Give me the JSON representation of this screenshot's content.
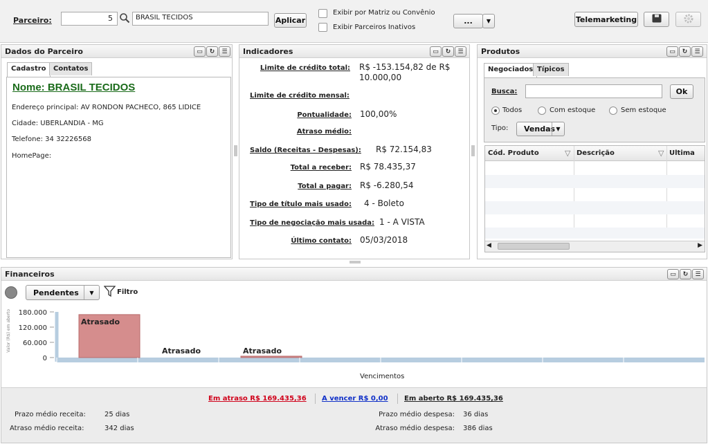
{
  "topbar": {
    "parceiro_label": "Parceiro:",
    "parceiro_code": "5",
    "parceiro_name": "BRASIL TECIDOS",
    "aplicar": "Aplicar",
    "chk_matriz": "Exibir por Matriz ou Convênio",
    "chk_inativos": "Exibir Parceiros Inativos",
    "more": "...",
    "telemarketing": "Telemarketing"
  },
  "dados": {
    "title": "Dados do Parceiro",
    "tabs": [
      "Cadastro",
      "Contatos"
    ],
    "nome": "Nome: BRASIL TECIDOS",
    "endereco": "Endereço principal: AV RONDON PACHECO, 865 LIDICE",
    "cidade": "Cidade: UBERLANDIA - MG",
    "telefone": "Telefone: 34  32226568",
    "homepage": "HomePage:"
  },
  "indicadores": {
    "title": "Indicadores",
    "rows": [
      {
        "label": "Limite de crédito total:",
        "value": "R$ -153.154,82 de R$ 10.000,00"
      },
      {
        "label": "Limite de crédito mensal:",
        "value": ""
      },
      {
        "label": "Pontualidade:",
        "value": "100,00%"
      },
      {
        "label": "Atraso médio:",
        "value": ""
      },
      {
        "label": "Saldo (Receitas - Despesas):",
        "value": "R$ 72.154,83"
      },
      {
        "label": "Total a receber:",
        "value": "R$ 78.435,37"
      },
      {
        "label": "Total a pagar:",
        "value": "R$ -6.280,54"
      },
      {
        "label": "Tipo de título mais usado:",
        "value": "4 - Boleto"
      },
      {
        "label": "Tipo de negociação mais usada:",
        "value": "1 - A VISTA"
      },
      {
        "label": "Último contato:",
        "value": "05/03/2018"
      }
    ]
  },
  "produtos": {
    "title": "Produtos",
    "tabs": [
      "Negociados",
      "Típicos"
    ],
    "busca_label": "Busca:",
    "ok": "Ok",
    "radios": [
      "Todos",
      "Com estoque",
      "Sem estoque"
    ],
    "tipo_label": "Tipo:",
    "tipo_value": "Vendas",
    "columns": [
      "Cód. Produto",
      "Descrição",
      "Ultima"
    ]
  },
  "financeiros": {
    "title": "Financeiros",
    "filter_select": "Pendentes",
    "filtro": "Filtro",
    "xlabel": "Vencimentos",
    "ylabel": "Valor (R$) em aberto"
  },
  "chart_data": {
    "type": "bar",
    "categories": [
      "",
      "",
      "",
      "",
      "",
      "",
      "",
      ""
    ],
    "series": [
      {
        "values": [
          169435.36,
          0,
          500,
          0,
          0,
          0,
          0,
          0
        ]
      }
    ],
    "data_labels": [
      "Atrasado",
      "Atrasado",
      "Atrasado",
      "",
      "",
      "",
      "",
      ""
    ],
    "yticks": [
      "180.000",
      "120.000",
      "60.000",
      "0"
    ],
    "ylim": [
      0,
      180000
    ]
  },
  "summary": {
    "em_atraso": "Em atraso R$ 169.435,36",
    "a_vencer": "A vencer R$ 0,00",
    "em_aberto": "Em aberto R$ 169.435,36",
    "prazo_receita_label": "Prazo médio receita:",
    "prazo_receita": "25 dias",
    "atraso_receita_label": "Atraso médio receita:",
    "atraso_receita": "342 dias",
    "prazo_despesa_label": "Prazo médio despesa:",
    "prazo_despesa": "36 dias",
    "atraso_despesa_label": "Atraso médio despesa:",
    "atraso_despesa": "386 dias"
  },
  "colors": {
    "bar": "#d58d8d",
    "bar_border": "#b86b6b",
    "axis": "#b7cde0",
    "link_red": "#d0021b",
    "link_blue": "#1030c8"
  }
}
